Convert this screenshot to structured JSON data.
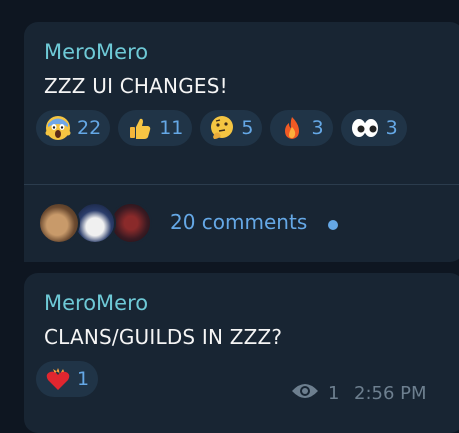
{
  "messages": [
    {
      "sender": "MeroMero",
      "text": "ZZZ UI CHANGES!",
      "reactions": [
        {
          "emoji": "screaming-face",
          "count": "22"
        },
        {
          "emoji": "thumbs-up",
          "count": "11"
        },
        {
          "emoji": "thinking-face",
          "count": "5"
        },
        {
          "emoji": "fire",
          "count": "3"
        },
        {
          "emoji": "eyes",
          "count": "3"
        }
      ],
      "comments_label": "20 comments"
    },
    {
      "sender": "MeroMero",
      "text": "CLANS/GUILDS IN ZZZ?",
      "reactions": [
        {
          "emoji": "heart-on-fire",
          "count": "1"
        }
      ],
      "views": "1",
      "time": "2:56 PM"
    }
  ],
  "colors": {
    "background": "#0e1621",
    "bubble": "#182533",
    "sender": "#6ec9d6",
    "accent": "#65a8e6",
    "reaction_bg": "#203447",
    "meta": "#6d7f8f"
  }
}
